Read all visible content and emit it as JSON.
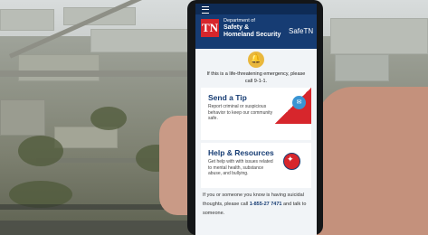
{
  "app": {
    "name": "SafeTN",
    "logo_text": "TN",
    "department_line1": "Department of",
    "department_line2": "Safety &",
    "department_line3": "Homeland Security"
  },
  "emergency_text": "If this is a life-threatening emergency, please call 9-1-1.",
  "cards": [
    {
      "title": "Send a Tip",
      "body": "Report criminal or suspicious behavior to keep our community safe."
    },
    {
      "title": "Help & Resources",
      "body": "Get help with with issues related to mental health, substance abuse, and bullying."
    }
  ],
  "suicide": {
    "text": "If you or someone you know is having suicidal thoughts, please call",
    "phone": "1-855-27 7471",
    "suffix": "and talk to someone."
  },
  "icons": [
    "menu-icon",
    "bell-icon",
    "chat-icon",
    "tennessee-star-icon"
  ],
  "colors": {
    "brand_blue": "#163c73",
    "brand_red": "#d7262c",
    "bell_gold": "#e9b73d",
    "chat_blue": "#3a95d4"
  }
}
